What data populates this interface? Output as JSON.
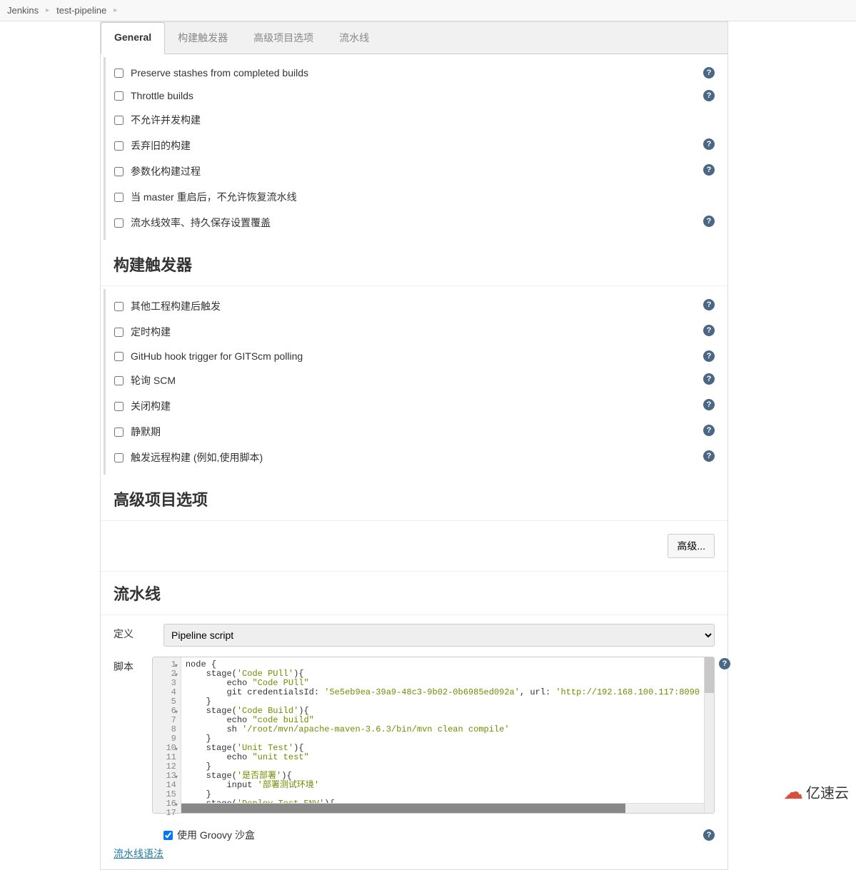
{
  "breadcrumb": {
    "items": [
      "Jenkins",
      "test-pipeline"
    ]
  },
  "tabs": {
    "general": "General",
    "triggers": "构建触发器",
    "advanced": "高级项目选项",
    "pipeline": "流水线"
  },
  "general": {
    "options": [
      {
        "label": "Preserve stashes from completed builds",
        "help": true,
        "checked": false
      },
      {
        "label": "Throttle builds",
        "help": true,
        "checked": false
      },
      {
        "label": "不允许并发构建",
        "help": false,
        "checked": false
      },
      {
        "label": "丢弃旧的构建",
        "help": true,
        "checked": false
      },
      {
        "label": "参数化构建过程",
        "help": true,
        "checked": false
      },
      {
        "label": "当 master 重启后，不允许恢复流水线",
        "help": false,
        "checked": false
      },
      {
        "label": "流水线效率、持久保存设置覆盖",
        "help": true,
        "checked": false
      }
    ]
  },
  "triggers": {
    "heading": "构建触发器",
    "options": [
      {
        "label": "其他工程构建后触发",
        "help": true,
        "checked": false
      },
      {
        "label": "定时构建",
        "help": true,
        "checked": false
      },
      {
        "label": "GitHub hook trigger for GITScm polling",
        "help": true,
        "checked": false
      },
      {
        "label": "轮询 SCM",
        "help": true,
        "checked": false
      },
      {
        "label": "关闭构建",
        "help": true,
        "checked": false
      },
      {
        "label": "静默期",
        "help": true,
        "checked": false
      },
      {
        "label": "触发远程构建 (例如,使用脚本)",
        "help": true,
        "checked": false
      }
    ]
  },
  "advancedSection": {
    "heading": "高级项目选项",
    "button": "高级..."
  },
  "pipeline": {
    "heading": "流水线",
    "definitionLabel": "定义",
    "definitionValue": "Pipeline script",
    "scriptLabel": "脚本",
    "groovySandbox": "使用 Groovy 沙盒",
    "syntaxLink": "流水线语法",
    "code": {
      "lines": [
        {
          "n": 1,
          "fold": true,
          "text": "node {"
        },
        {
          "n": 2,
          "fold": true,
          "text": "    stage(",
          "str": "'Code PUll'",
          "tail": "){"
        },
        {
          "n": 3,
          "fold": false,
          "text": "        echo ",
          "str": "\"Code PUll\""
        },
        {
          "n": 4,
          "fold": false,
          "text": "        git credentialsId: ",
          "str": "'5e5eb9ea-39a9-48c3-9b02-0b6985ed092a'",
          "mid": ", url: ",
          "str2": "'http://192.168.100.117:8090"
        },
        {
          "n": 5,
          "fold": false,
          "text": "    }"
        },
        {
          "n": 6,
          "fold": true,
          "text": "    stage(",
          "str": "'Code Build'",
          "tail": "){"
        },
        {
          "n": 7,
          "fold": false,
          "text": "        echo ",
          "str": "\"code build\""
        },
        {
          "n": 8,
          "fold": false,
          "text": "        sh ",
          "str": "'/root/mvn/apache-maven-3.6.3/bin/mvn clean compile'"
        },
        {
          "n": 9,
          "fold": false,
          "text": "    }"
        },
        {
          "n": 10,
          "fold": true,
          "text": "    stage(",
          "str": "'Unit Test'",
          "tail": "){"
        },
        {
          "n": 11,
          "fold": false,
          "text": "        echo ",
          "str": "\"unit test\""
        },
        {
          "n": 12,
          "fold": false,
          "text": "    }"
        },
        {
          "n": 13,
          "fold": true,
          "text": "    stage(",
          "str": "'是否部署'",
          "tail": "){"
        },
        {
          "n": 14,
          "fold": false,
          "text": "        input ",
          "str": "'部署测试环境'"
        },
        {
          "n": 15,
          "fold": false,
          "text": "    }"
        },
        {
          "n": 16,
          "fold": true,
          "text": "    stage(",
          "str": "'Deploy Test ENV'",
          "tail": "){"
        },
        {
          "n": 17,
          "fold": false,
          "text": ""
        }
      ]
    }
  },
  "watermark": "亿速云"
}
